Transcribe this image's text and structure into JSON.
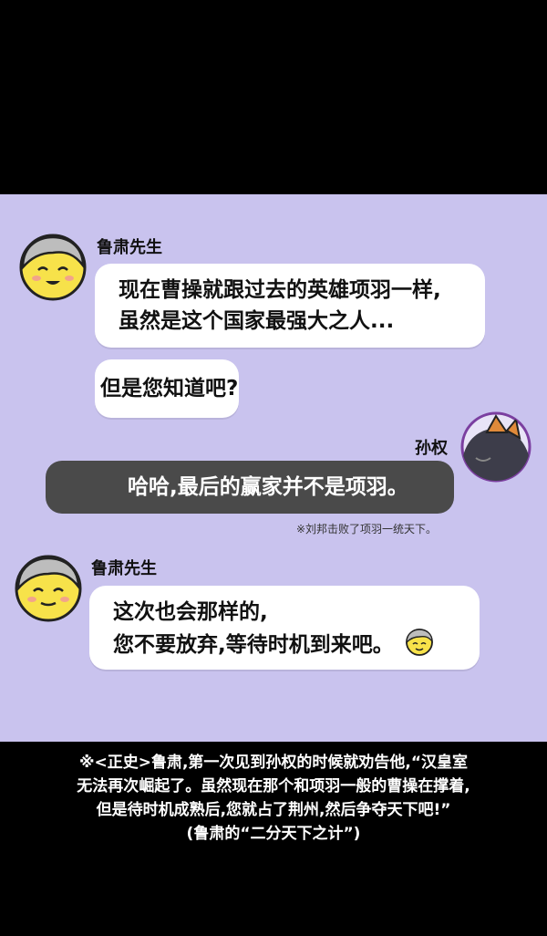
{
  "messages": [
    {
      "sender": "鲁肃先生",
      "lines": [
        "现在曹操就跟过去的英雄项羽一样,",
        "虽然是这个国家最强大之人..."
      ]
    },
    {
      "lines": [
        "但是您知道吧?"
      ]
    },
    {
      "sender": "孙权",
      "lines": [
        "哈哈,最后的赢家并不是项羽。"
      ],
      "note": "※刘邦击败了项羽一统天下。"
    },
    {
      "sender": "鲁肃先生",
      "lines": [
        "这次也会那样的,",
        "您不要放弃,等待时机到来吧。"
      ]
    }
  ],
  "footer": {
    "lines": [
      "※<正史>鲁肃,第一次见到孙权的时候就劝告他,“汉皇室",
      "无法再次崛起了。虽然现在那个和项羽一般的曹操在撑着,",
      "但是待时机成熟后,您就占了荆州,然后争夺天下吧!”",
      "(鲁肃的“二分天下之计”)"
    ]
  },
  "colors": {
    "chat_background": "#c9c3ee",
    "dark_bubble": "#4a4a4a",
    "face": "#f7e24a",
    "hair": "#bdbdbd"
  },
  "icons": [
    "lusu-avatar-icon",
    "sunquan-avatar-icon",
    "smile-emoji-icon"
  ]
}
